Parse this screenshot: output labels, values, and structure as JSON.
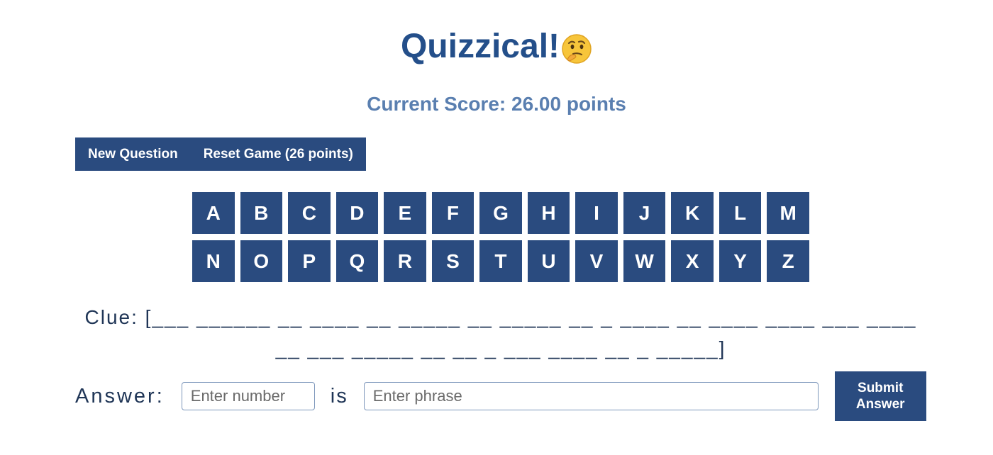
{
  "header": {
    "title": "Quizzical!",
    "emoji": "thinking-face"
  },
  "score": {
    "text": "Current Score: 26.00 points"
  },
  "toolbar": {
    "new_question_label": "New Question",
    "reset_label": "Reset Game (26 points)"
  },
  "keyboard": {
    "row1": [
      "A",
      "B",
      "C",
      "D",
      "E",
      "F",
      "G",
      "H",
      "I",
      "J",
      "K",
      "L",
      "M"
    ],
    "row2": [
      "N",
      "O",
      "P",
      "Q",
      "R",
      "S",
      "T",
      "U",
      "V",
      "W",
      "X",
      "Y",
      "Z"
    ]
  },
  "clue": {
    "label": "Clue:",
    "text": "[___ ______ __ ____ __ _____ __ _____ __ _ ____ __ ____ ____ ___ ____ __ ___ _____ __ __ _ ___ ____ __ _ _____]"
  },
  "answer": {
    "label": "Answer:",
    "number_placeholder": "Enter number",
    "is_label": "is",
    "phrase_placeholder": "Enter phrase",
    "submit_label": "Submit Answer"
  },
  "colors": {
    "primary": "#2a4b7f",
    "title": "#244f8a",
    "score": "#5a7fb0",
    "text": "#1f3556"
  }
}
